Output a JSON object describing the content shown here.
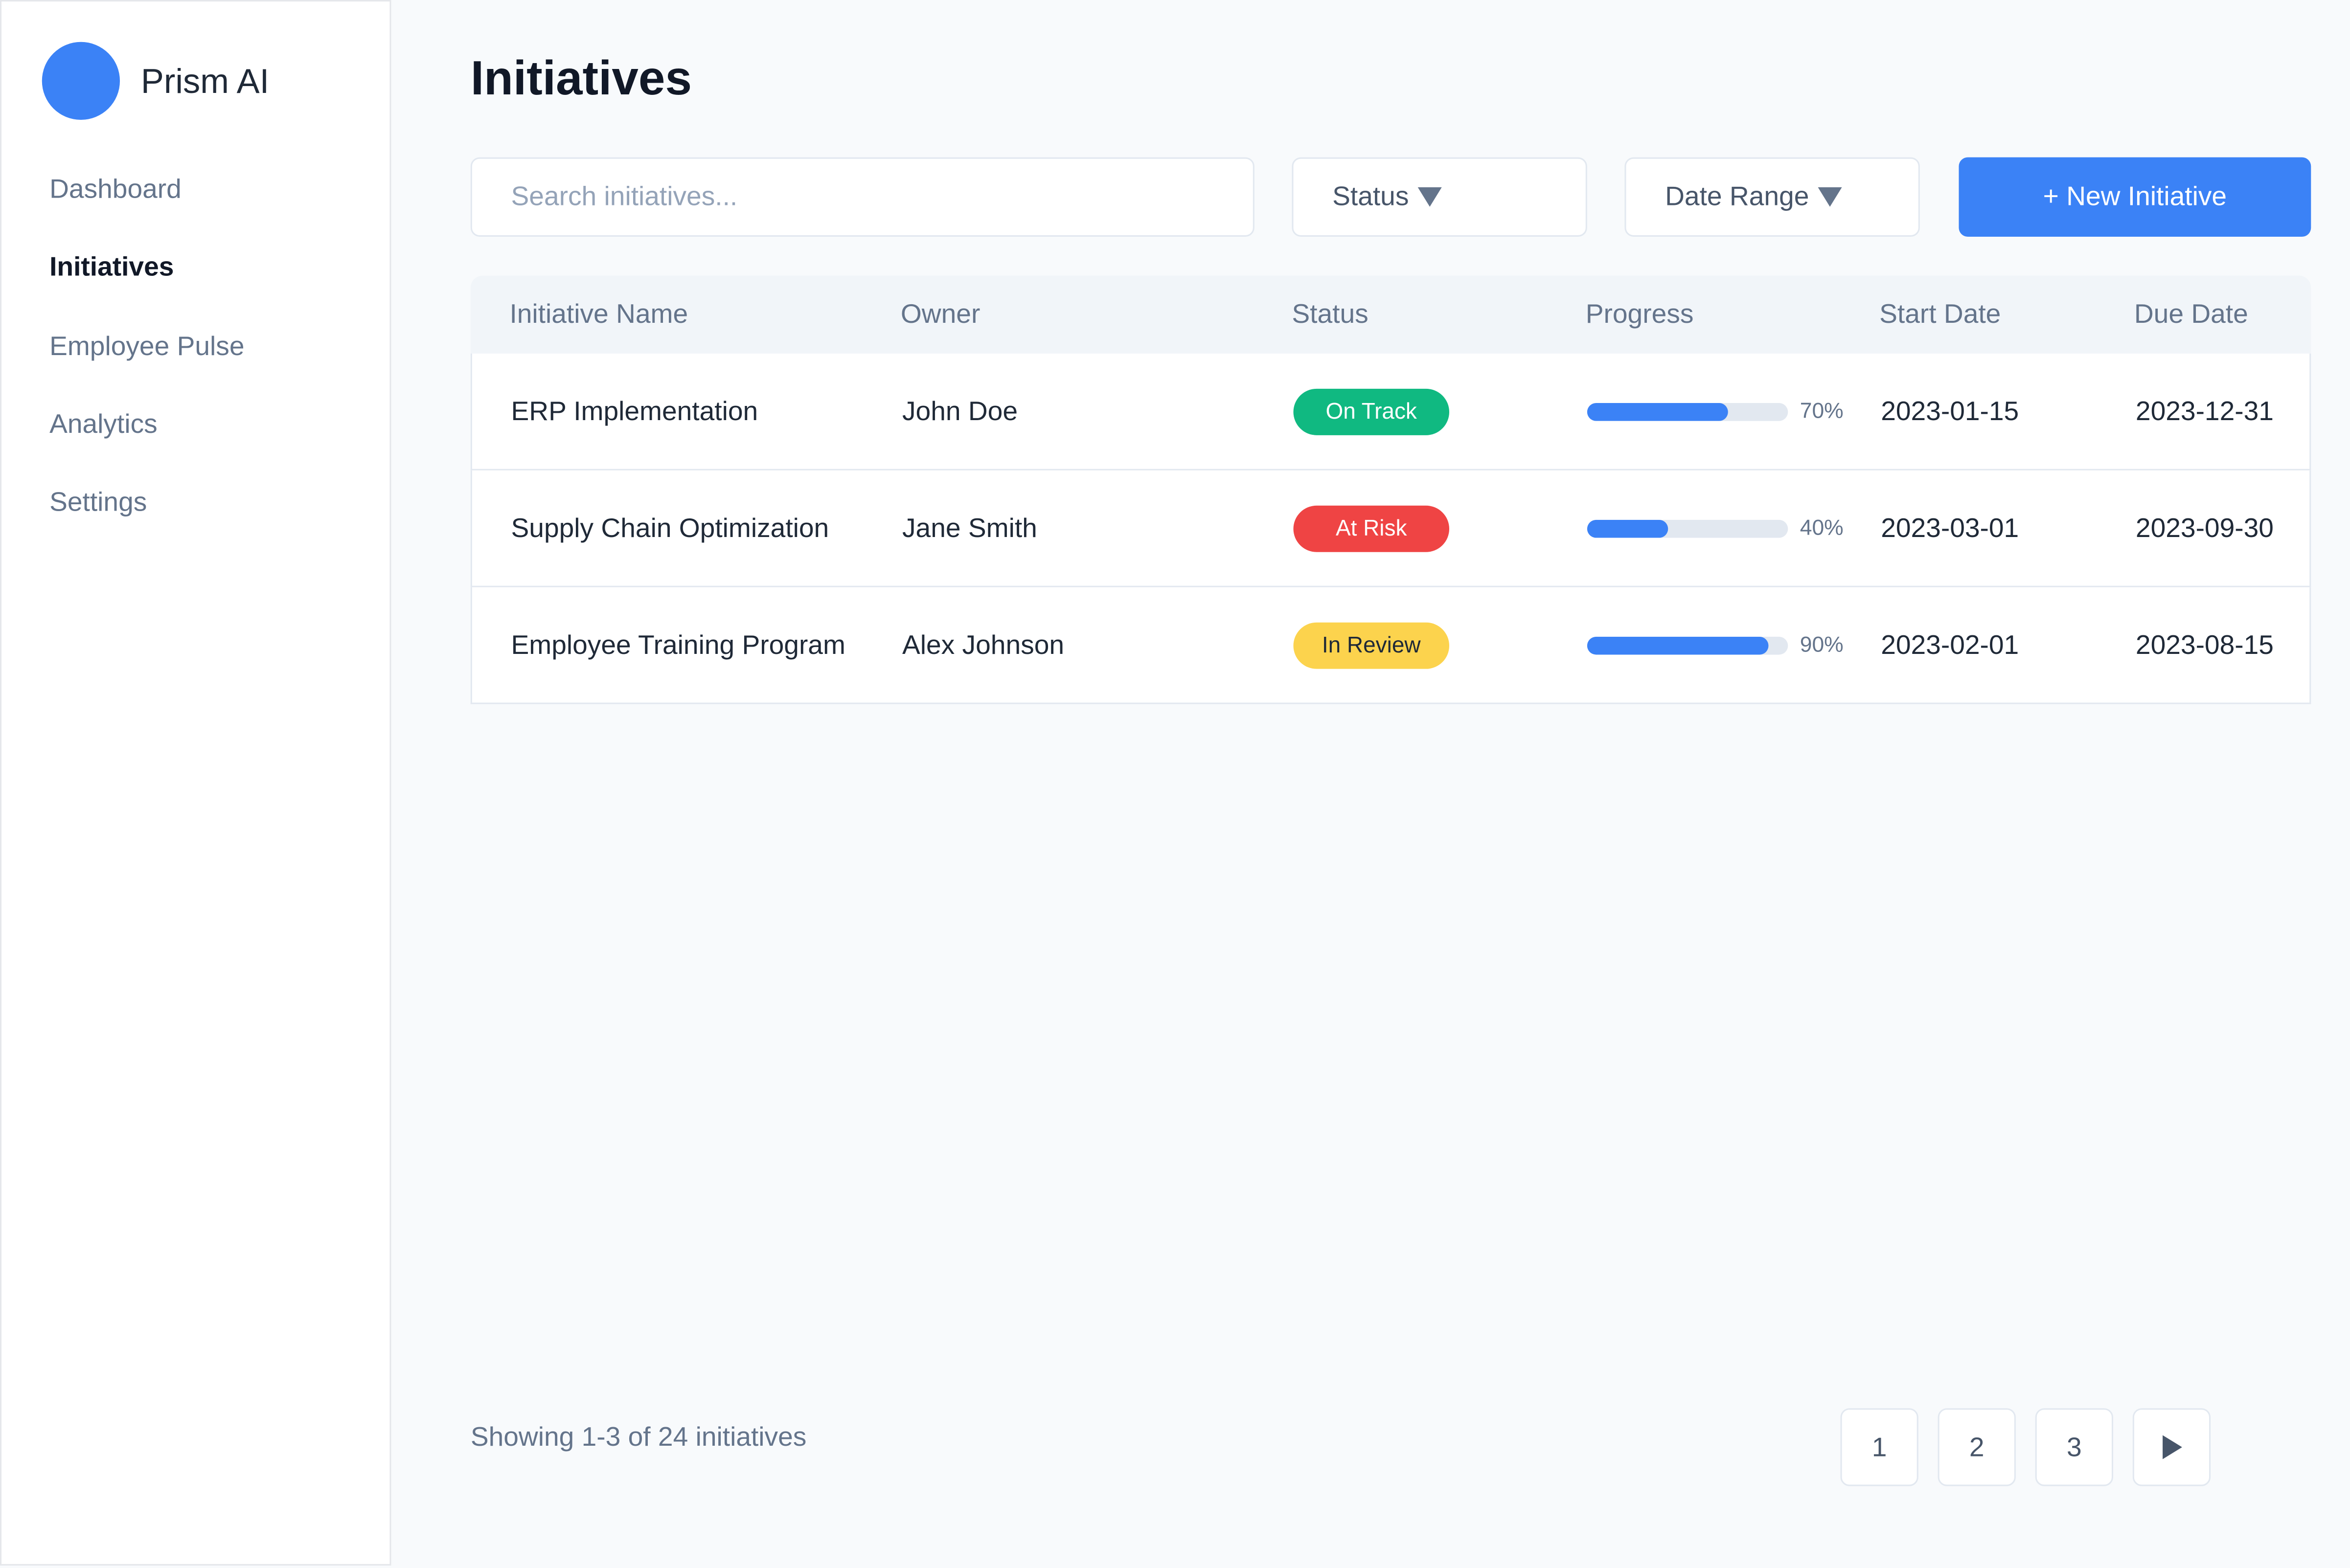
{
  "brand": {
    "name": "Prism AI",
    "logo_color": "#3b82f6"
  },
  "sidebar": {
    "items": [
      {
        "label": "Dashboard",
        "active": false
      },
      {
        "label": "Initiatives",
        "active": true
      },
      {
        "label": "Employee Pulse",
        "active": false
      },
      {
        "label": "Analytics",
        "active": false
      },
      {
        "label": "Settings",
        "active": false
      }
    ]
  },
  "page": {
    "title": "Initiatives"
  },
  "toolbar": {
    "search_placeholder": "Search initiatives...",
    "search_value": "",
    "status_filter": "Status",
    "date_filter": "Date Range",
    "new_button": "+ New Initiative"
  },
  "table": {
    "headers": [
      "Initiative Name",
      "Owner",
      "Status",
      "Progress",
      "Start Date",
      "Due Date"
    ],
    "rows": [
      {
        "name": "ERP Implementation",
        "owner": "John Doe",
        "status": "On Track",
        "status_color": "#10b981",
        "status_text_color": "#ffffff",
        "progress": 70,
        "progress_label": "70%",
        "start": "2023-01-15",
        "due": "2023-12-31"
      },
      {
        "name": "Supply Chain Optimization",
        "owner": "Jane Smith",
        "status": "At Risk",
        "status_color": "#ef4444",
        "status_text_color": "#ffffff",
        "progress": 40,
        "progress_label": "40%",
        "start": "2023-03-01",
        "due": "2023-09-30"
      },
      {
        "name": "Employee Training Program",
        "owner": "Alex Johnson",
        "status": "In Review",
        "status_color": "#fcd34d",
        "status_text_color": "#1f2937",
        "progress": 90,
        "progress_label": "90%",
        "start": "2023-02-01",
        "due": "2023-08-15"
      }
    ]
  },
  "footer": {
    "showing": "Showing 1-3 of 24 initiatives",
    "pages": [
      "1",
      "2",
      "3"
    ],
    "next_icon": "play-right-icon"
  }
}
